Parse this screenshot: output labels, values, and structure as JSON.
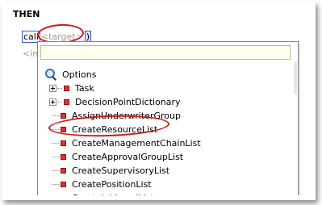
{
  "section": {
    "title": "THEN"
  },
  "statement": {
    "keyword": "call",
    "target_placeholder": "<target>",
    "paren": ")"
  },
  "insert_hint": "<ins",
  "dropdown": {
    "header": {
      "label": "Options",
      "icon": "search-icon"
    },
    "filter_value": "",
    "items": [
      {
        "label": "Task",
        "expandable": true
      },
      {
        "label": "DecisionPointDictionary",
        "expandable": true
      },
      {
        "label": "AssignUnderwriterGroup",
        "expandable": false
      },
      {
        "label": "CreateResourceList",
        "expandable": false,
        "highlighted": true
      },
      {
        "label": "CreateManagementChainList",
        "expandable": false
      },
      {
        "label": "CreateApprovalGroupList",
        "expandable": false
      },
      {
        "label": "CreateSupervisoryList",
        "expandable": false
      },
      {
        "label": "CreatePositionList",
        "expandable": false
      },
      {
        "label": "CreateJobLevelList",
        "expandable": false
      }
    ]
  },
  "colors": {
    "annotation_circle": "#cc1c1c",
    "selection_border": "#3355cc",
    "item_icon": "#dd3333"
  }
}
